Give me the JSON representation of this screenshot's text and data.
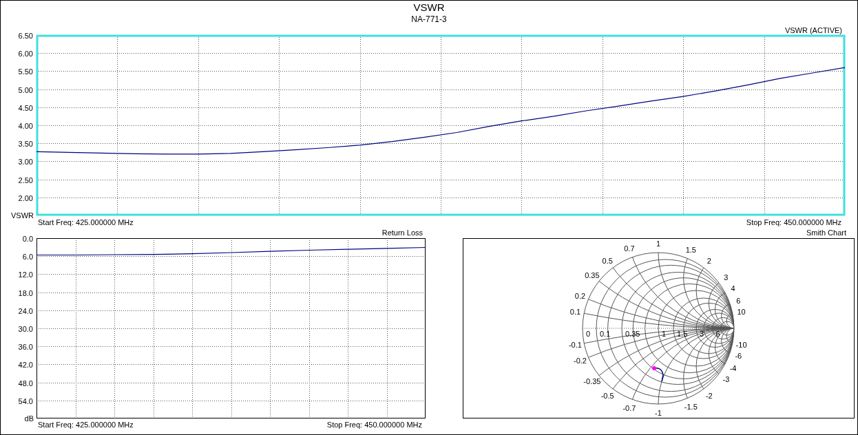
{
  "window": {
    "title": "VSWR",
    "subtitle": "NA-771-3"
  },
  "vswr_chart": {
    "active": true,
    "trace_label": "VSWR (ACTIVE)",
    "axis_label": "VSWR",
    "start_label": "Start Freq: 425.000000 MHz",
    "stop_label": "Stop Freq: 450.000000 MHz",
    "chart_data": {
      "type": "line",
      "categories": [
        null,
        null,
        null,
        null,
        null,
        null,
        null,
        null,
        null,
        null,
        null,
        null,
        null,
        null,
        null,
        null,
        null,
        null,
        null,
        null,
        null,
        null,
        null,
        null,
        null,
        null
      ],
      "series": [
        {
          "color": "#000080",
          "values": [
            3.27,
            3.25,
            3.23,
            3.21,
            3.2,
            3.2,
            3.22,
            3.27,
            3.32,
            3.38,
            3.45,
            3.55,
            3.67,
            3.8,
            3.97,
            4.12,
            4.25,
            4.4,
            4.53,
            4.67,
            4.8,
            4.95,
            5.12,
            5.3,
            5.45,
            5.6
          ]
        }
      ],
      "ylim": [
        1.5,
        6.5
      ],
      "grid": true,
      "yticks": [
        {
          "value": 2,
          "label": "2.00"
        },
        {
          "value": 2.5,
          "label": "2.50"
        },
        {
          "value": 3,
          "label": "3.00"
        },
        {
          "value": 3.5,
          "label": "3.50"
        },
        {
          "value": 4,
          "label": "4.00"
        },
        {
          "value": 4.5,
          "label": "4.50"
        },
        {
          "value": 5,
          "label": "5.00"
        },
        {
          "value": 5.5,
          "label": "5.50"
        },
        {
          "value": 6,
          "label": "6.00"
        },
        {
          "value": 6.5,
          "label": "6.50"
        }
      ]
    }
  },
  "return_loss_chart": {
    "active": false,
    "title": "Return Loss",
    "axis_label": "dB",
    "start_label": "Start Freq: 425.000000 MHz",
    "stop_label": "Stop Freq: 450.000000 MHz",
    "chart_data": {
      "type": "line",
      "categories": [
        null,
        null,
        null,
        null,
        null,
        null,
        null,
        null,
        null,
        null,
        null
      ],
      "series": [
        {
          "color": "#000080",
          "values": [
            5.6,
            5.6,
            5.5,
            5.4,
            5.2,
            4.8,
            4.4,
            4.0,
            3.7,
            3.4,
            3.1
          ]
        }
      ],
      "ylim": [
        60,
        0
      ],
      "grid": true,
      "yticks": [
        {
          "value": 0,
          "label": "0.0"
        },
        {
          "value": 6,
          "label": "6.0"
        },
        {
          "value": 12,
          "label": "12.0"
        },
        {
          "value": 18,
          "label": "18.0"
        },
        {
          "value": 24,
          "label": "24.0"
        },
        {
          "value": 30,
          "label": "30.0"
        },
        {
          "value": 36,
          "label": "36.0"
        },
        {
          "value": 42,
          "label": "42.0"
        },
        {
          "value": 48,
          "label": "48.0"
        },
        {
          "value": 54,
          "label": "54.0"
        }
      ]
    }
  },
  "smith_chart": {
    "title": "Smith Chart",
    "resistance_labels": [
      "0",
      "0.1",
      "0.35",
      "1",
      "1.5",
      "3",
      "6"
    ],
    "reactance_labels": [
      "0.1",
      "0.2",
      "0.35",
      "0.5",
      "0.7",
      "1",
      "1.5",
      "2",
      "3",
      "4",
      "6",
      "10"
    ],
    "lower_left_reactance_labels": [
      "-0.1",
      "-0.2",
      "-0.35",
      "-0.5",
      "-0.7",
      "-1"
    ],
    "lower_right_reactance_labels": [
      "-10",
      "-6",
      "-4",
      "-3",
      "-2",
      "-1.5"
    ]
  }
}
